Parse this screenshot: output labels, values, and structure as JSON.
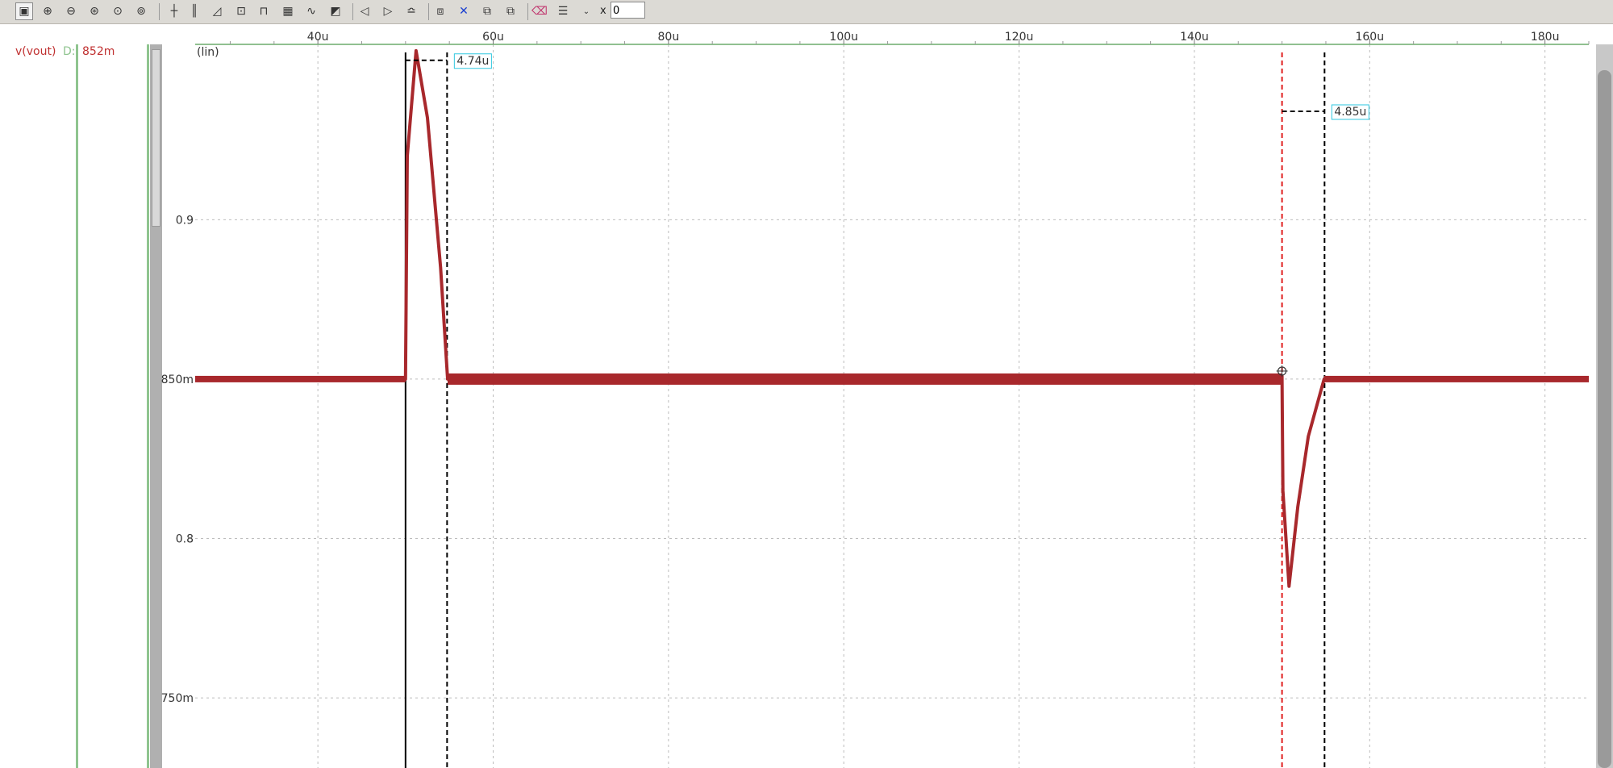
{
  "toolbar": {
    "icons": [
      "zoom-fit-icon",
      "zoom-in-icon",
      "zoom-out-icon",
      "zoom-x-icon",
      "zoom-y-icon",
      "zoom-full-icon",
      "cursor-cross-icon",
      "cursor-bars-icon",
      "measure-icon",
      "annotate-icon",
      "pulse-icon",
      "grid-icon",
      "wave-icon",
      "chart-props-icon",
      "prev-icon",
      "next-icon",
      "fft-icon",
      "frame-icon",
      "delete-icon",
      "link-icon",
      "unlink-icon",
      "eraser-icon",
      "settings-icon"
    ],
    "x_label": "x",
    "x_value": "0"
  },
  "signal": {
    "name": "v(vout)",
    "d_label": "D:",
    "value": "852m",
    "color": "#a8282c"
  },
  "chart_data": {
    "type": "line",
    "scale_label": "(lin)",
    "x_tick_labels": [
      "40u",
      "60u",
      "80u",
      "100u",
      "120u",
      "140u",
      "160u",
      "180u"
    ],
    "x_ticks": [
      40,
      60,
      80,
      100,
      120,
      140,
      160,
      180
    ],
    "y_tick_labels": [
      "0.9",
      "850m",
      "0.8",
      "750m"
    ],
    "y_ticks": [
      0.9,
      0.85,
      0.8,
      0.75
    ],
    "xlim": [
      26,
      185
    ],
    "ylim": [
      0.728,
      0.955
    ],
    "grid": true,
    "series": [
      {
        "name": "v(vout)",
        "color": "#a8282c",
        "x": [
          26,
          50,
          50.2,
          51.2,
          52.5,
          54.0,
          54.8,
          150,
          150.1,
          150.8,
          151.8,
          153.0,
          154.8,
          185
        ],
        "y": [
          0.85,
          0.85,
          0.92,
          0.953,
          0.932,
          0.885,
          0.85,
          0.851,
          0.815,
          0.785,
          0.81,
          0.832,
          0.85,
          0.85
        ]
      }
    ],
    "cursors": [
      {
        "x": 50.0,
        "style": "solid",
        "color": "#000000"
      },
      {
        "x": 54.74,
        "style": "dashed",
        "color": "#000000"
      },
      {
        "x": 150.0,
        "style": "dashed",
        "color": "#e02020"
      },
      {
        "x": 154.85,
        "style": "dashed",
        "color": "#000000"
      }
    ],
    "measurements": [
      {
        "label": "4.74u",
        "x_from": 50.0,
        "x_to": 54.74,
        "y": 0.95
      },
      {
        "label": "4.85u",
        "x_from": 150.0,
        "x_to": 154.85,
        "y": 0.934
      }
    ]
  }
}
